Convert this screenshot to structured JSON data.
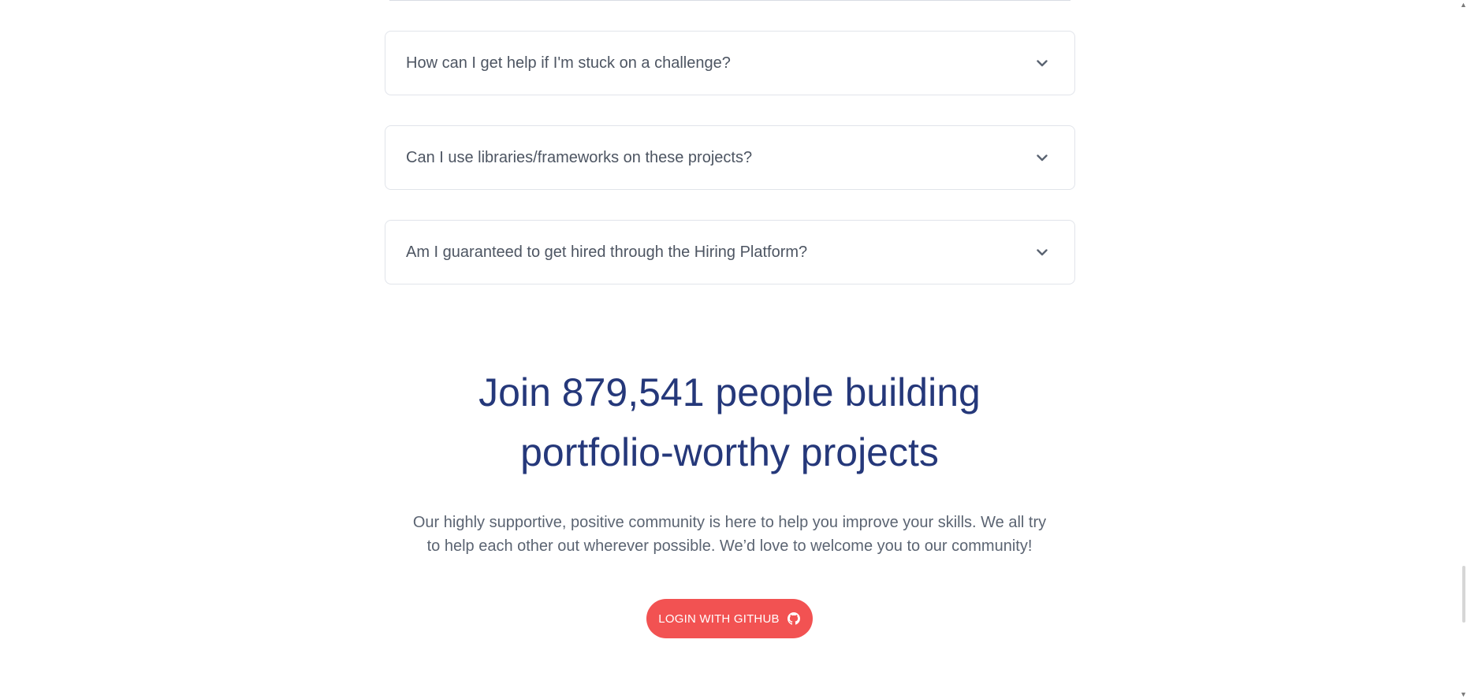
{
  "faq": {
    "items": [
      {
        "question": "How can I get help if I'm stuck on a challenge?"
      },
      {
        "question": "Can I use libraries/frameworks on these projects?"
      },
      {
        "question": "Am I guaranteed to get hired through the Hiring Platform?"
      }
    ]
  },
  "cta": {
    "title_line1": "Join 879,541 people building",
    "title_line2": "portfolio-worthy projects",
    "description_line1": "Our highly supportive, positive community is here to help you improve your skills. We all try",
    "description_line2": "to help each other out wherever possible. We’d love to welcome you to our community!",
    "button_label": "LOGIN WITH GITHUB"
  },
  "colors": {
    "heading": "#25387a",
    "button": "#f25252",
    "body_text": "#5b6472"
  },
  "icons": {
    "faq_toggle": "chevron-down-icon",
    "button": "github-icon"
  }
}
